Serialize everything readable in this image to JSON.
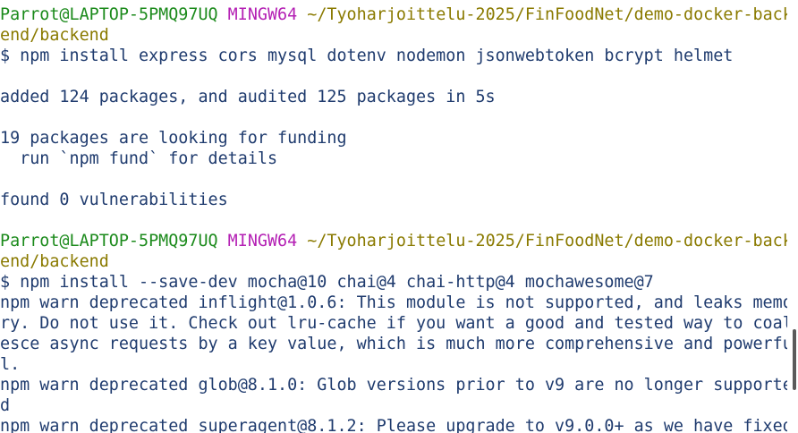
{
  "prompts": [
    {
      "user_host": "Parrot@LAPTOP-5PMQ97UQ",
      "shell": "MINGW64",
      "path_line1": "~/Tyoharjoittelu-2025/FinFoodNet/demo-docker-back",
      "path_line2": "end/backend",
      "command": "$ npm install express cors mysql dotenv nodemon jsonwebtoken bcrypt helmet"
    },
    {
      "user_host": "Parrot@LAPTOP-5PMQ97UQ",
      "shell": "MINGW64",
      "path_line1": "~/Tyoharjoittelu-2025/FinFoodNet/demo-docker-back",
      "path_line2": "end/backend",
      "command": "$ npm install --save-dev mocha@10 chai@4 chai-http@4 mochawesome@7"
    }
  ],
  "output1": [
    "added 124 packages, and audited 125 packages in 5s",
    "19 packages are looking for funding",
    "  run `npm fund` for details",
    "found 0 vulnerabilities"
  ],
  "output2": [
    "npm warn deprecated inflight@1.0.6: This module is not supported, and leaks memo",
    "ry. Do not use it. Check out lru-cache if you want a good and tested way to coal",
    "esce async requests by a key value, which is much more comprehensive and powerfu",
    "l.",
    "npm warn deprecated glob@8.1.0: Glob versions prior to v9 are no longer supporte",
    "d",
    "npm warn deprecated superagent@8.1.2: Please upgrade to v9.0.0+ as we have fixed"
  ],
  "colors": {
    "user_host": "#1b8a1b",
    "shell": "#b420b4",
    "path": "#8a7a00",
    "text": "#1f3b6e",
    "background": "#ffffff"
  }
}
